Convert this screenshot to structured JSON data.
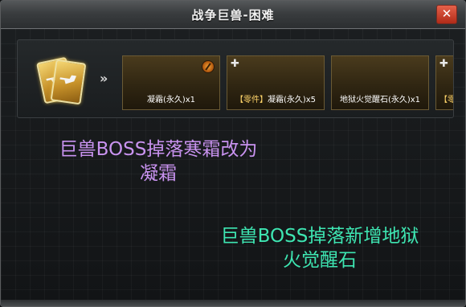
{
  "window": {
    "title": "战争巨兽-困难",
    "close_symbol": "✕"
  },
  "rewards": {
    "arrow": "»",
    "items": [
      {
        "label": "凝霜(永久)x1",
        "tag": "",
        "icon": "rune-icon"
      },
      {
        "label": "凝霜(永久)x5",
        "tag": "【零件】",
        "icon": "puzzle-icon"
      },
      {
        "label": "地狱火觉醒石(永久)x1",
        "tag": "",
        "icon": ""
      },
      {
        "label": "",
        "tag": "【零",
        "icon": "puzzle-icon"
      }
    ]
  },
  "annotations": {
    "line1a": "巨兽BOSS掉落寒霜改为",
    "line1b": "凝霜",
    "line2a": "巨兽BOSS掉落新增地狱",
    "line2b": "火觉醒石",
    "color1": "#c993f0",
    "color2": "#3ee6b2"
  }
}
